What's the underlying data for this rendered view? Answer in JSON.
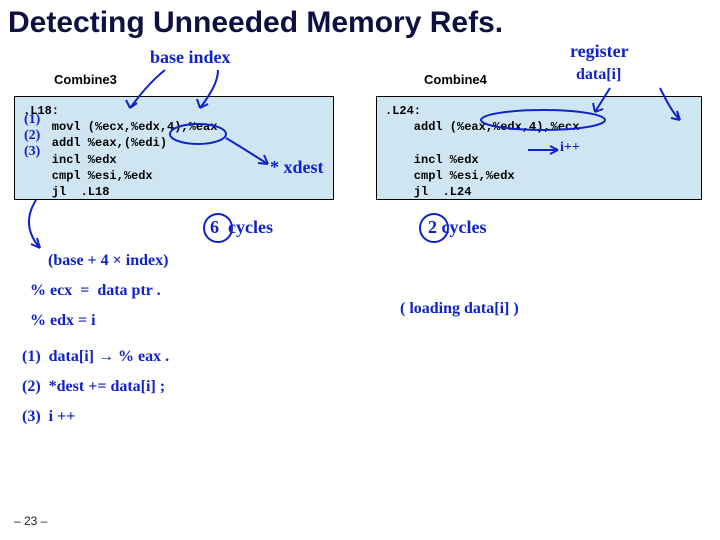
{
  "title": "Detecting Unneeded Memory Refs.",
  "left": {
    "label": "Combine3",
    "code": ".L18:\n    movl (%ecx,%edx,4),%eax\n    addl %eax,(%edi)\n    incl %edx\n    cmpl %esi,%edx\n    jl  .L18"
  },
  "right": {
    "label": "Combine4",
    "code": ".L24:\n    addl (%eax,%edx,4),%ecx\n\n    incl %edx\n    cmpl %esi,%edx\n    jl  .L24"
  },
  "footer": "– 23 –",
  "hand": {
    "base_index": "base index",
    "register": "register",
    "datai": "data[i]",
    "n1": "(1)",
    "n2": "(2)",
    "n3": "(3)",
    "xdest": "* xdest",
    "ipp_r": "i++",
    "cycles6": "6  cycles",
    "cycles2": "2 cycles",
    "eq1": "(base + 4 × index)",
    "eq2": "% ecx  =  data ptr .",
    "eq3": "% edx = i",
    "loading": "( loading data[i] )",
    "map1": "(1)  data[i] → % eax .",
    "map2": "(2)  *dest += data[i] ;",
    "map3": "(3)  i ++"
  }
}
